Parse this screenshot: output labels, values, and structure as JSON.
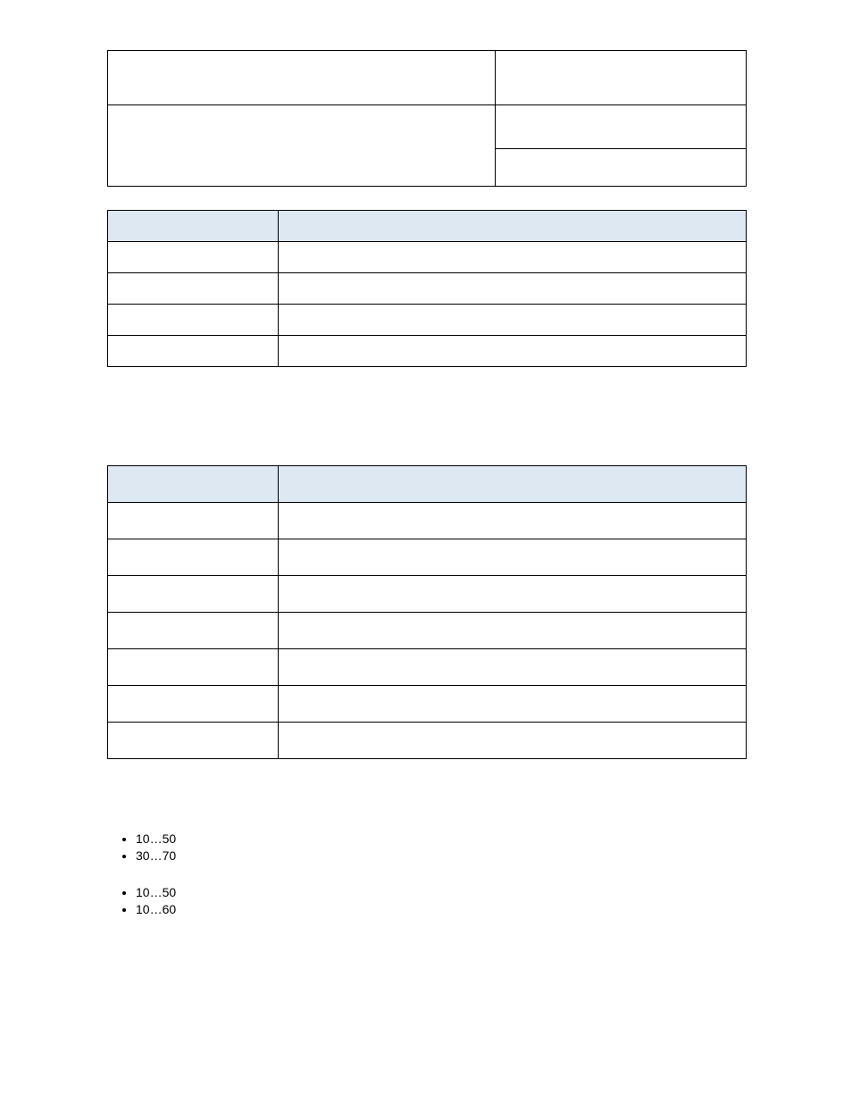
{
  "table1": {
    "rows": [
      {
        "left": "",
        "right": [
          ""
        ]
      },
      {
        "left": "",
        "right": [
          "",
          ""
        ]
      }
    ]
  },
  "table2": {
    "header": {
      "col_a": "",
      "col_b": ""
    },
    "rows": [
      {
        "col_a": "",
        "col_b": ""
      },
      {
        "col_a": "",
        "col_b": ""
      },
      {
        "col_a": "",
        "col_b": ""
      },
      {
        "col_a": "",
        "col_b": ""
      }
    ]
  },
  "table3": {
    "header": {
      "col_a": "",
      "col_b": ""
    },
    "rows": [
      {
        "col_a": "",
        "col_b": ""
      },
      {
        "col_a": "",
        "col_b": ""
      },
      {
        "col_a": "",
        "col_b": ""
      },
      {
        "col_a": "",
        "col_b": ""
      },
      {
        "col_a": "",
        "col_b": ""
      },
      {
        "col_a": "",
        "col_b": ""
      },
      {
        "col_a": "",
        "col_b": ""
      }
    ]
  },
  "lists": [
    {
      "items": [
        "10…50",
        "30…70"
      ]
    },
    {
      "items": [
        "10…50",
        "10…60"
      ]
    }
  ]
}
